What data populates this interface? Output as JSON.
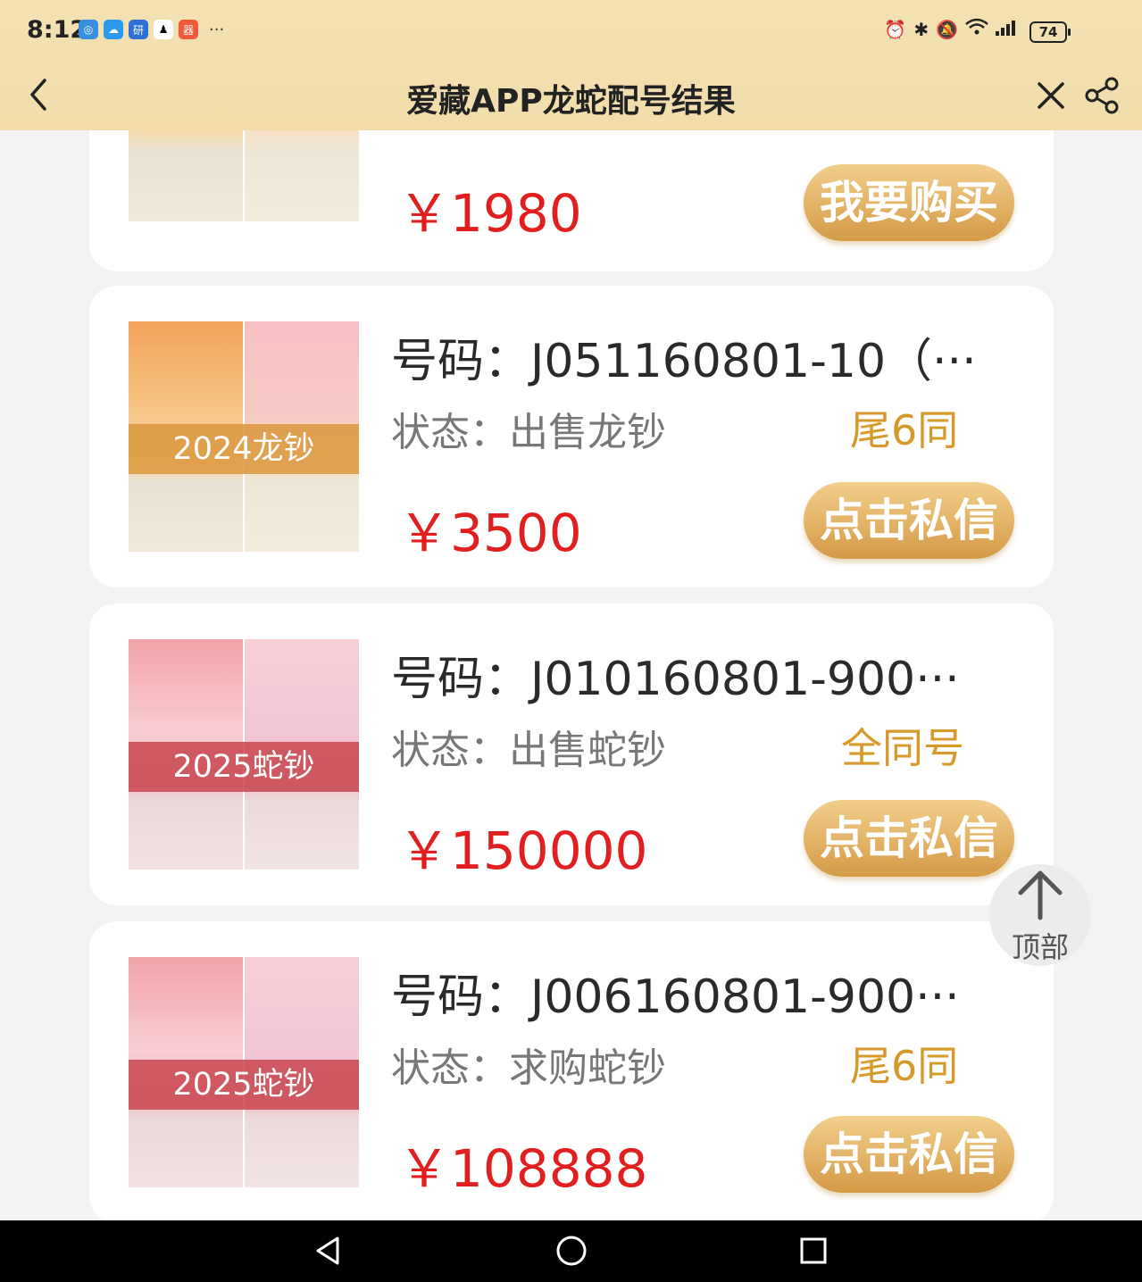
{
  "status_bar": {
    "time": "8:12",
    "overflow": "···",
    "battery": "74"
  },
  "header": {
    "title": "爱藏APP龙蛇配号结果"
  },
  "listings": [
    {
      "price": "￥1980",
      "button": "我要购买",
      "band_label": "",
      "tone": "orange"
    },
    {
      "number": "号码：J051160801-10（···",
      "status": "状态：出售龙钞",
      "tag": "尾6同",
      "price": "￥3500",
      "button": "点击私信",
      "band_label": "2024龙钞",
      "tone": "orange"
    },
    {
      "number": "号码：J010160801-900···",
      "status": "状态：出售蛇钞",
      "tag": "全同号",
      "price": "￥150000",
      "button": "点击私信",
      "band_label": "2025蛇钞",
      "tone": "pink"
    },
    {
      "number": "号码：J006160801-900···",
      "status": "状态：求购蛇钞",
      "tag": "尾6同",
      "price": "￥108888",
      "button": "点击私信",
      "band_label": "2025蛇钞",
      "tone": "pink"
    }
  ],
  "to_top": {
    "label": "顶部"
  },
  "colors": {
    "header_bg": "#f2dfb0",
    "price": "#e21f1f",
    "tag": "#d79a2a",
    "button_top": "#f2cf8c",
    "button_bottom": "#d49a46"
  },
  "icons": [
    "back-arrow-icon",
    "close-icon",
    "share-icon",
    "arrow-up-icon",
    "nav-back-icon",
    "nav-home-icon",
    "nav-recents-icon"
  ]
}
